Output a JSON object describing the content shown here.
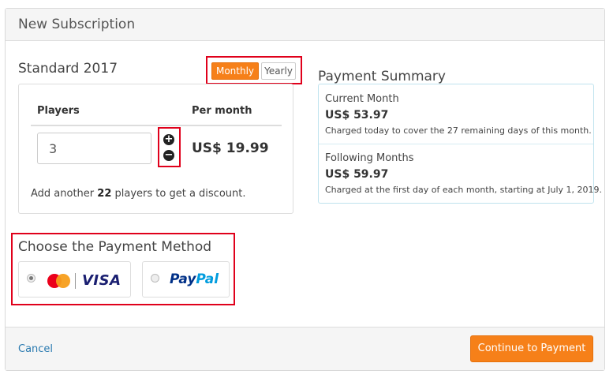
{
  "modal": {
    "title": "New Subscription"
  },
  "plan": {
    "title": "Standard 2017",
    "billing_options": [
      "Monthly",
      "Yearly"
    ],
    "selected_billing": "Monthly",
    "table": {
      "col_players": "Players",
      "col_per_month": "Per month",
      "players_value": "3",
      "price": "US$ 19.99"
    },
    "discount_note": {
      "prefix": "Add another",
      "count": "22",
      "suffix": "players to get a discount."
    }
  },
  "summary": {
    "title": "Payment Summary",
    "current": {
      "label": "Current Month",
      "amount": "US$ 53.97",
      "note": "Charged today to cover the 27 remaining days of this month."
    },
    "following": {
      "label": "Following Months",
      "amount": "US$ 59.97",
      "note": "Charged at the first day of each month, starting at July 1, 2019."
    }
  },
  "payment": {
    "title": "Choose the Payment Method",
    "options": [
      {
        "brand": "VISA",
        "icon": "mastercard-logo",
        "selected": true
      },
      {
        "brand_part1": "Pay",
        "brand_part2": "Pal",
        "selected": false
      }
    ]
  },
  "footer": {
    "cancel_label": "Cancel",
    "continue_label": "Continue to Payment"
  },
  "colors": {
    "accent_orange": "#f68019",
    "highlight_red": "#e0001b",
    "link_blue": "#2a7ab0",
    "summary_border": "#bfe3ee"
  },
  "icons": {
    "stepper_plus": "plus-circle-icon",
    "stepper_minus": "minus-circle-icon"
  }
}
